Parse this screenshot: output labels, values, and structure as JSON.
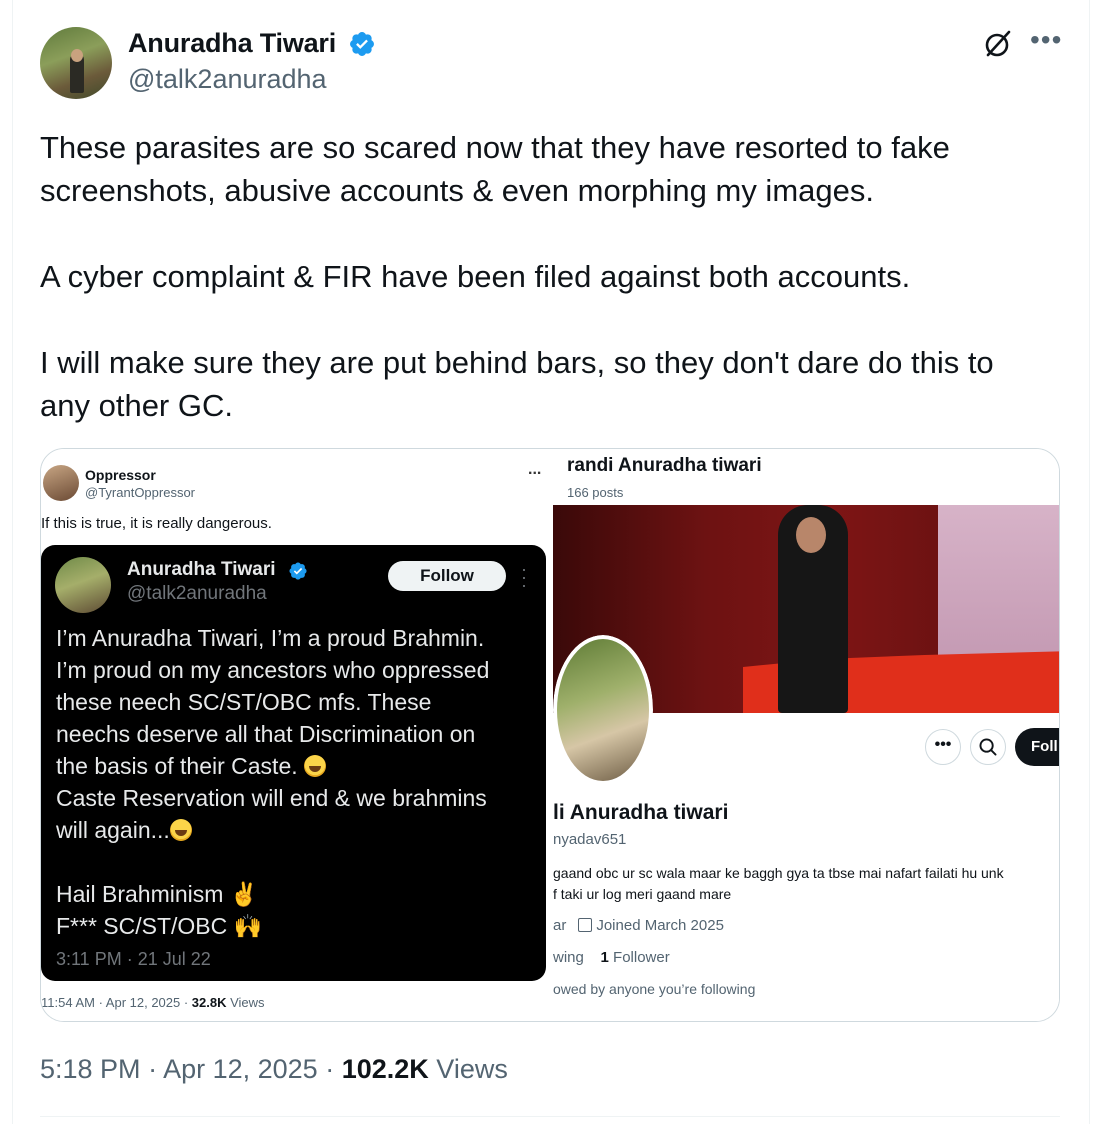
{
  "author": {
    "name": "Anuradha Tiwari",
    "handle": "@talk2anuradha",
    "verified": true
  },
  "tweet": {
    "paragraphs": [
      "These parasites are so scared now that they have resorted to fake screenshots, abusive accounts & even morphing my images.",
      "A cyber complaint & FIR have been filed against both accounts.",
      "I will make sure they are put behind bars, so they don't dare do this to any other GC."
    ],
    "time": "5:18 PM",
    "date": "Apr 12, 2025",
    "views_count": "102.2K",
    "views_label": "Views"
  },
  "icons": {
    "grok": "grok-icon",
    "more": "more-icon",
    "verified": "verified-badge-icon"
  },
  "colors": {
    "text": "#0f1419",
    "secondary": "#536471",
    "verified_blue": "#1d9bf0"
  },
  "left_image": {
    "quoter_name": "Oppressor",
    "quoter_handle": "@TyrantOppressor",
    "dots": "...",
    "quoter_text": "If this is true, it is really dangerous.",
    "embedded": {
      "name": "Anuradha Tiwari",
      "handle": "@talk2anuradha",
      "follow_label": "Follow",
      "lines": [
        "I’m Anuradha Tiwari, I’m a proud Brahmin.",
        "I’m proud on my ancestors who oppressed",
        "these neech SC/ST/OBC mfs. These",
        "neechs deserve all that Discrimination on",
        "the basis of their Caste.",
        "Caste Reservation will end & we brahmins",
        "will again...",
        "Hail Brahminism",
        "F*** SC/ST/OBC"
      ],
      "timestamp": "3:11 PM · 21 Jul 22"
    },
    "footer_time": "11:54 AM · Apr 12, 2025 · ",
    "footer_views": "32.8K",
    "footer_views_label": " Views"
  },
  "right_image": {
    "title": "randi Anuradha tiwari",
    "posts": "166 posts",
    "more_label": "•••",
    "follow_label": "Foll",
    "name": "li Anuradha tiwari",
    "handle": "nyadav651",
    "bio_lines": [
      "gaand obc ur sc wala maar ke baggh gya ta tbse mai nafart failati hu unk",
      "f taki ur log meri gaand mare"
    ],
    "meta_prefix": "ar",
    "joined": "Joined March 2025",
    "following_prefix": "wing",
    "followers_count": "1",
    "followers_label": " Follower",
    "followed_by": "owed by anyone you’re following"
  }
}
